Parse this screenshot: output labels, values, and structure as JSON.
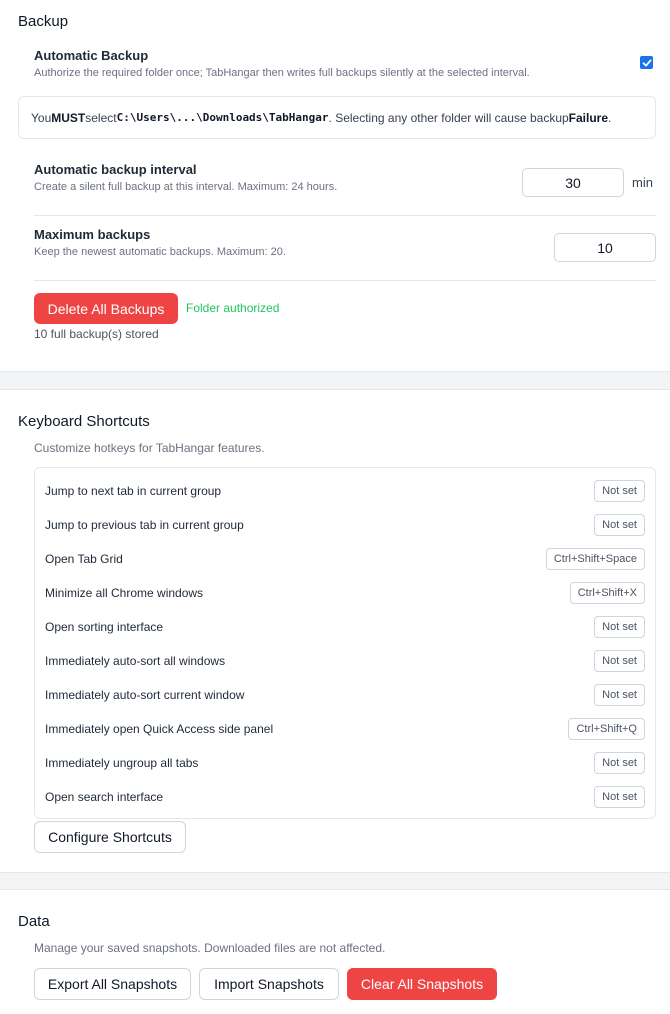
{
  "backup": {
    "title": "Backup",
    "auto": {
      "label": "Automatic Backup",
      "description": "Authorize the required folder once; TabHangar then writes full backups silently at the selected interval.",
      "checked": true
    },
    "warning": {
      "prefix": "You ",
      "must": "MUST",
      "select": " select ",
      "path": "C:\\Users\\...\\Downloads\\TabHangar",
      "middle": ". Selecting any other folder will cause backup ",
      "failure": "Failure",
      "suffix": "."
    },
    "interval": {
      "label": "Automatic backup interval",
      "description": "Create a silent full backup at this interval. Maximum: 24 hours.",
      "value": "30",
      "unit": "min"
    },
    "max": {
      "label": "Maximum backups",
      "description": "Keep the newest automatic backups. Maximum: 20.",
      "value": "10"
    },
    "delete_label": "Delete All Backups",
    "folder_status": "Folder authorized",
    "stored_text": "10 full backup(s) stored"
  },
  "shortcuts": {
    "title": "Keyboard Shortcuts",
    "description": "Customize hotkeys for TabHangar features.",
    "items": [
      {
        "name": "Jump to next tab in current group",
        "key": "Not set"
      },
      {
        "name": "Jump to previous tab in current group",
        "key": "Not set"
      },
      {
        "name": "Open Tab Grid",
        "key": "Ctrl+Shift+Space"
      },
      {
        "name": "Minimize all Chrome windows",
        "key": "Ctrl+Shift+X"
      },
      {
        "name": "Open sorting interface",
        "key": "Not set"
      },
      {
        "name": "Immediately auto-sort all windows",
        "key": "Not set"
      },
      {
        "name": "Immediately auto-sort current window",
        "key": "Not set"
      },
      {
        "name": "Immediately open Quick Access side panel",
        "key": "Ctrl+Shift+Q"
      },
      {
        "name": "Immediately ungroup all tabs",
        "key": "Not set"
      },
      {
        "name": "Open search interface",
        "key": "Not set"
      }
    ],
    "configure_label": "Configure Shortcuts"
  },
  "data": {
    "title": "Data",
    "description": "Manage your saved snapshots. Downloaded files are not affected.",
    "export_label": "Export All Snapshots",
    "import_label": "Import Snapshots",
    "clear_label": "Clear All Snapshots"
  },
  "colors": {
    "accent_blue": "#1a73e8",
    "danger_red": "#ef4444",
    "success_green": "#22c55e"
  }
}
